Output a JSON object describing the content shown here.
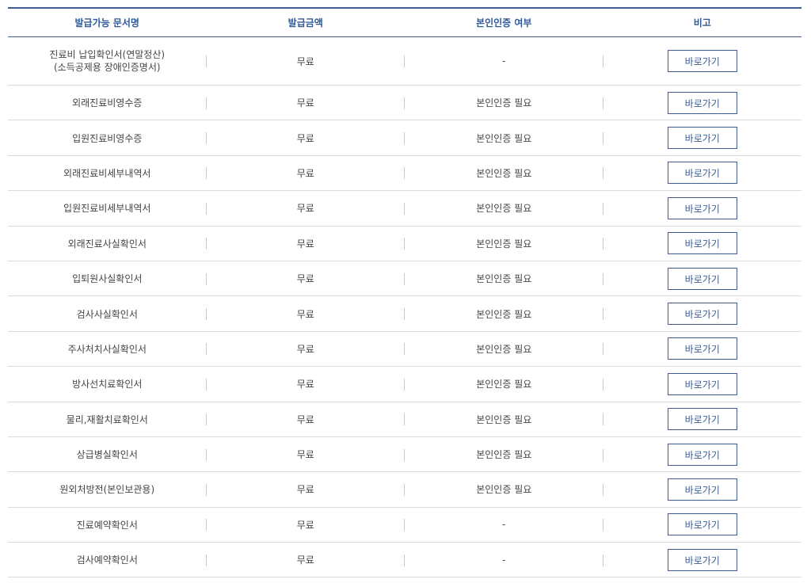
{
  "table": {
    "headers": {
      "doc_name": "발급가능 문서명",
      "fee": "발급금액",
      "auth": "본인인증 여부",
      "note": "비고"
    },
    "rows": [
      {
        "name": "진료비 납입확인서(연말정산)",
        "name_line2": "(소득공제용 장애인증명서)",
        "fee": "무료",
        "auth": "-",
        "button": "바로가기"
      },
      {
        "name": "외래진료비영수증",
        "fee": "무료",
        "auth": "본인인증 필요",
        "button": "바로가기"
      },
      {
        "name": "입원진료비영수증",
        "fee": "무료",
        "auth": "본인인증 필요",
        "button": "바로가기"
      },
      {
        "name": "외래진료비세부내역서",
        "fee": "무료",
        "auth": "본인인증 필요",
        "button": "바로가기"
      },
      {
        "name": "입원진료비세부내역서",
        "fee": "무료",
        "auth": "본인인증 필요",
        "button": "바로가기"
      },
      {
        "name": "외래진료사실확인서",
        "fee": "무료",
        "auth": "본인인증 필요",
        "button": "바로가기"
      },
      {
        "name": "입퇴원사실확인서",
        "fee": "무료",
        "auth": "본인인증 필요",
        "button": "바로가기"
      },
      {
        "name": "검사사실확인서",
        "fee": "무료",
        "auth": "본인인증 필요",
        "button": "바로가기"
      },
      {
        "name": "주사처치사실확인서",
        "fee": "무료",
        "auth": "본인인증 필요",
        "button": "바로가기"
      },
      {
        "name": "방사선치료확인서",
        "fee": "무료",
        "auth": "본인인증 필요",
        "button": "바로가기"
      },
      {
        "name": "물리,재활치료확인서",
        "fee": "무료",
        "auth": "본인인증 필요",
        "button": "바로가기"
      },
      {
        "name": "상급병실확인서",
        "fee": "무료",
        "auth": "본인인증 필요",
        "button": "바로가기"
      },
      {
        "name": "원외처방전(본인보관용)",
        "fee": "무료",
        "auth": "본인인증 필요",
        "button": "바로가기"
      },
      {
        "name": "진료예약확인서",
        "fee": "무료",
        "auth": "-",
        "button": "바로가기"
      },
      {
        "name": "검사예약확인서",
        "fee": "무료",
        "auth": "-",
        "button": "바로가기"
      }
    ]
  }
}
